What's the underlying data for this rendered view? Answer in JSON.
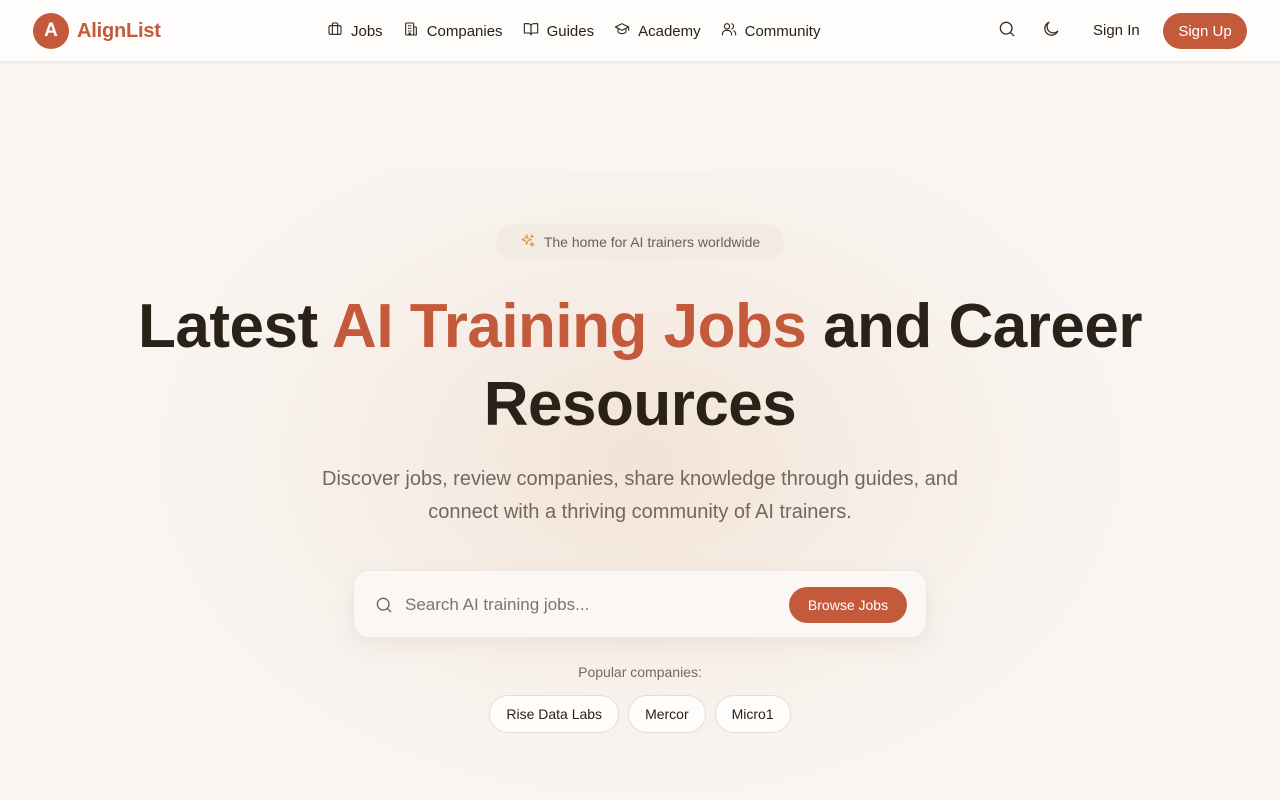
{
  "header": {
    "logo_letter": "A",
    "logo_text": "AlignList",
    "nav": [
      {
        "label": "Jobs",
        "icon": "briefcase-icon"
      },
      {
        "label": "Companies",
        "icon": "building-icon"
      },
      {
        "label": "Guides",
        "icon": "book-open-icon"
      },
      {
        "label": "Academy",
        "icon": "graduation-cap-icon"
      },
      {
        "label": "Community",
        "icon": "users-icon"
      }
    ],
    "sign_in": "Sign In",
    "sign_up": "Sign Up"
  },
  "hero": {
    "badge": "The home for AI trainers worldwide",
    "title_pre": "Latest ",
    "title_accent": "AI Training Jobs",
    "title_post": " and Career Resources",
    "subtitle": "Discover jobs, review companies, share knowledge through guides, and connect with a thriving community of AI trainers."
  },
  "search": {
    "placeholder": "Search AI training jobs...",
    "value": "",
    "button": "Browse Jobs"
  },
  "popular": {
    "label": "Popular companies:",
    "companies": [
      "Rise Data Labs",
      "Mercor",
      "Micro1"
    ]
  },
  "colors": {
    "accent": "#c45a3c",
    "background": "#f9f5f2",
    "text": "#2a2118",
    "muted": "#73685f",
    "sparkle": "#d49a3c"
  }
}
